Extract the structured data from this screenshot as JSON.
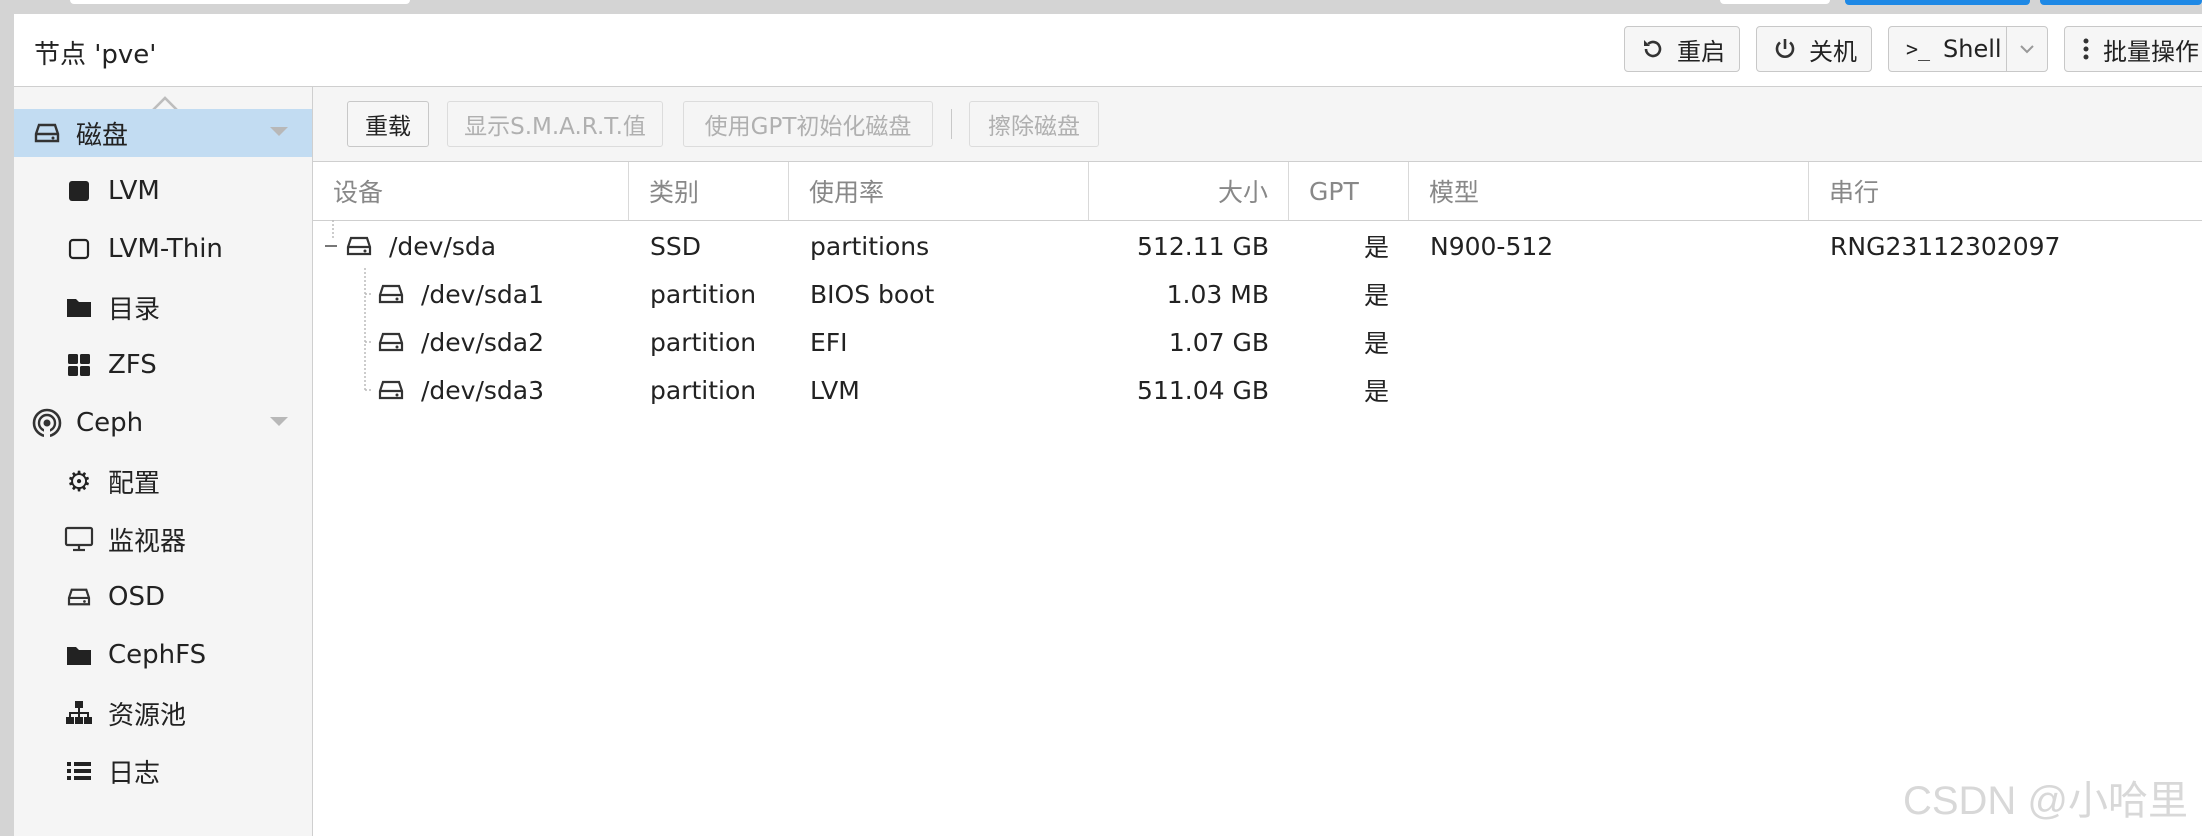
{
  "header": {
    "title": "节点 'pve'",
    "buttons": {
      "reboot": "重启",
      "shutdown": "关机",
      "shell": "Shell",
      "bulk": "批量操作"
    }
  },
  "sidebar": {
    "items": [
      {
        "label": "磁盘",
        "icon": "hdd-icon"
      },
      {
        "label": "LVM",
        "icon": "square-icon"
      },
      {
        "label": "LVM-Thin",
        "icon": "square-outline-icon"
      },
      {
        "label": "目录",
        "icon": "folder-icon"
      },
      {
        "label": "ZFS",
        "icon": "grid-icon"
      },
      {
        "label": "Ceph",
        "icon": "ceph-icon"
      },
      {
        "label": "配置",
        "icon": "gear-icon"
      },
      {
        "label": "监视器",
        "icon": "monitor-icon"
      },
      {
        "label": "OSD",
        "icon": "hdd-icon"
      },
      {
        "label": "CephFS",
        "icon": "folder-icon"
      },
      {
        "label": "资源池",
        "icon": "sitemap-icon"
      },
      {
        "label": "日志",
        "icon": "list-icon"
      }
    ]
  },
  "toolbar": {
    "reload": "重载",
    "smart": "显示S.M.A.R.T.值",
    "gpt_init": "使用GPT初始化磁盘",
    "wipe": "擦除磁盘"
  },
  "grid": {
    "columns": [
      "设备",
      "类别",
      "使用率",
      "大小",
      "GPT",
      "模型",
      "串行"
    ],
    "rows": [
      {
        "device": "/dev/sda",
        "type": "SSD",
        "usage": "partitions",
        "size": "512.11 GB",
        "gpt": "是",
        "model": "N900-512",
        "serial": "RNG23112302097"
      },
      {
        "device": "/dev/sda1",
        "type": "partition",
        "usage": "BIOS boot",
        "size": "1.03 MB",
        "gpt": "是",
        "model": "",
        "serial": ""
      },
      {
        "device": "/dev/sda2",
        "type": "partition",
        "usage": "EFI",
        "size": "1.07 GB",
        "gpt": "是",
        "model": "",
        "serial": ""
      },
      {
        "device": "/dev/sda3",
        "type": "partition",
        "usage": "LVM",
        "size": "511.04 GB",
        "gpt": "是",
        "model": "",
        "serial": ""
      }
    ]
  },
  "watermark": "CSDN @小哈里",
  "colors": {
    "selected": "#c2dcf2",
    "accent": "#1e88e5"
  }
}
